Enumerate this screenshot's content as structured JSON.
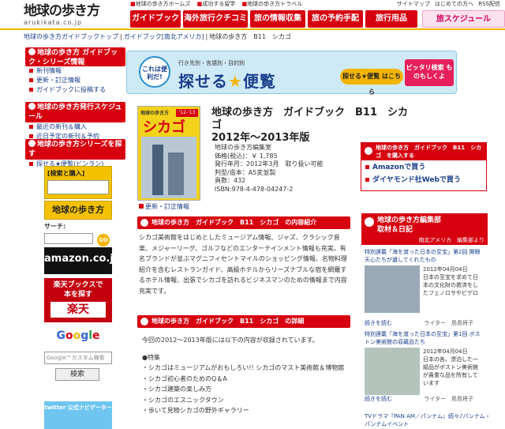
{
  "header": {
    "logo_text": "地球の歩き方",
    "logo_sub": "arukikata.co.jp",
    "ticker": [
      {
        "mark": "■",
        "text": "地球の歩き方ホームズ"
      },
      {
        "mark": "■",
        "text": "成功する留学"
      },
      {
        "mark": "■",
        "text": "地球の歩き方トラベル"
      }
    ],
    "util_links": [
      "サイトマップ",
      "はじめての方へ",
      "RSS配信"
    ],
    "nav": [
      "ガイドブック",
      "海外旅行クチコミ",
      "旅の情報収集",
      "旅の予約手配",
      "旅行用品",
      "旅スケジュール"
    ]
  },
  "breadcrumb": [
    "地球の歩き方ガイドブックトップ",
    "ガイドブック[南北アメリカ]",
    "地球の歩き方　B11　シカゴ"
  ],
  "left": {
    "block1_title": "地球の歩き方 ガイドブック・シリーズ情報",
    "block1_links": [
      "新刊情報",
      "更新・訂正情報",
      "ガイドブックに投稿する"
    ],
    "block2_title": "地球の歩き方発行スケジュール",
    "block2_links": [
      "最近の新刊＆購入",
      "近日予定の新刊＆予約"
    ],
    "block3_title": "地球の歩き方シリーズを探す",
    "block3_links": [
      "探せる★便覧(ビンラン)"
    ],
    "search_label": "[検索と購入]",
    "side_logo": "地球の歩き方",
    "saach_label": "サーチ:",
    "go_label": "GO",
    "amazon_text": "amazon.co.jp",
    "rakuten_line1": "楽天ブックスで",
    "rakuten_line2": "本を探す",
    "rakuten_logo": "楽天",
    "google_letters": [
      "G",
      "o",
      "o",
      "g",
      "l",
      "e"
    ],
    "google_placeholder": "Google™カスタム検索",
    "search_button": "検索",
    "twitter_text": "twitter 公式ナビゲーター"
  },
  "banner": {
    "badge": "これは便利だ!",
    "small": "行き先別・言語別・目的別",
    "big_pre": "探せる",
    "big_post": "便覧",
    "button": "探せる★便覧 はこちら",
    "pink": "ピッタリ検索 ものもしくよ"
  },
  "book": {
    "cover_series": "地球の歩き方",
    "cover_title": "シカゴ",
    "cover_edition": "'12-'13",
    "cover_link": "更新・訂正情報",
    "title_line1": "地球の歩き方　ガイドブック　B11　シカゴ",
    "title_line2": "2012年〜2013年版",
    "meta": [
      "地球の歩き方編集室",
      "価格(税込)：￥ 1,785",
      "発行年月：2012年3月　取り扱い可能",
      "判型/造本：A5変並製",
      "頁数：432",
      "ISBN:978-4-478-04247-2"
    ]
  },
  "buybox": {
    "header": "地球の歩き方　ガイドブック　B11　シカゴ　を購入する",
    "links": [
      "Amazonで買う",
      "ダイヤモンド社Webで買う"
    ]
  },
  "sections": {
    "intro_heading": "地球の歩き方　ガイドブック　B11　シカゴ　の内容紹介",
    "intro_text": "シカゴ美術館をはじめとしたミュージアム情報、ジャズ、クラシック音楽、メジャーリーグ、ゴルフなどのエンターテインメント情報も充実。有名ブランドが並ぶマグニフィセントマイルのショッピング情報、名物料理紹介を含むレストランガイド、高級ホテルからリーズナブルな宿を網羅するホテル情報、出張でシカゴを訪れるビジネスマンのための情報まで内容充実です。",
    "detail_heading": "地球の歩き方　ガイドブック　B11　シカゴ　の詳細",
    "detail_intro": "今回の2012〜2013年版には以下の内容が収録されています。",
    "detail_items": [
      "●特集",
      "・シカゴはミュージアムがおもしろい!! シカゴのマスト美術館＆博物館",
      "・シカゴ初心者のためのQ＆A",
      "・シカゴ建築の楽しみ方",
      "・シカゴのエスニックタウン",
      "・歩いて見物シカゴの野外ギャラリー"
    ]
  },
  "blog": {
    "title_line1": "地球の歩き方編集部",
    "title_line2": "取材＆日記",
    "subtitle": "南北アメリカ　編集部より",
    "entries": [
      {
        "title": "特別連載「海を渡った日本の至宝」第2回 開眼天心たちが遺してくれたもの",
        "date": "2012年04月04日",
        "text": "日本の至宝を求めて日本の文化財の救済をしたフェノロサやビゲロ",
        "more": "続きを読む",
        "writer": "ライター　鳥島将子"
      },
      {
        "title": "特別連載「海を渡った日本の至宝」第1回 ボストン美術館の収蔵品たち",
        "date": "2012年04月04日",
        "text": "日本の各、漂泊した一級品がボストン美術館が貴重な品を所有しています",
        "more": "続きを読む",
        "writer": "ライター　鳥島将子"
      }
    ],
    "tv_link": "TVドラマ『PAN AM／パンナム』続々♪パンナム・パンナムイベント"
  }
}
